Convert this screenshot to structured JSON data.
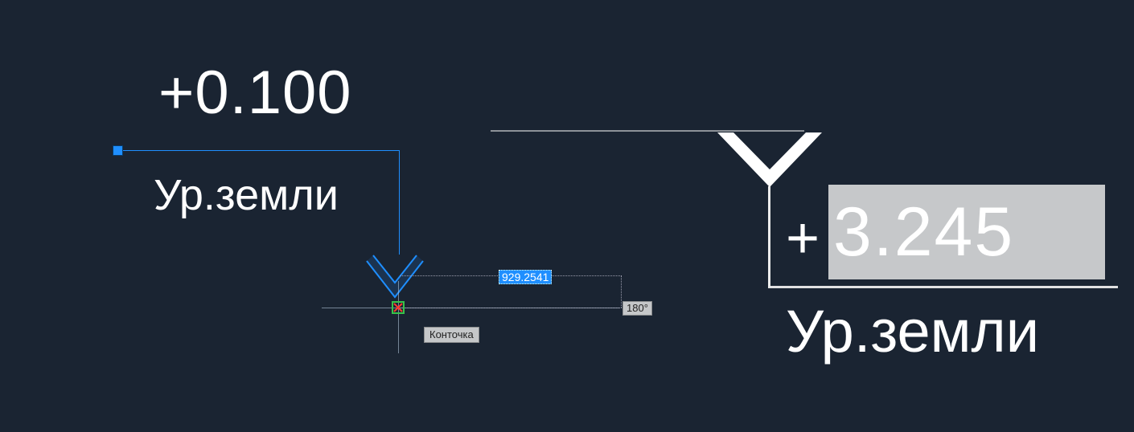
{
  "left_marker": {
    "value": "+0.100",
    "label": "Ур.земли"
  },
  "right_marker": {
    "prefix": "+",
    "edit_value": "3.245",
    "label": "Ур.земли"
  },
  "dynamic_input": {
    "distance": "929.2541",
    "angle": "180°"
  },
  "osnap_tooltip": "Конточка"
}
